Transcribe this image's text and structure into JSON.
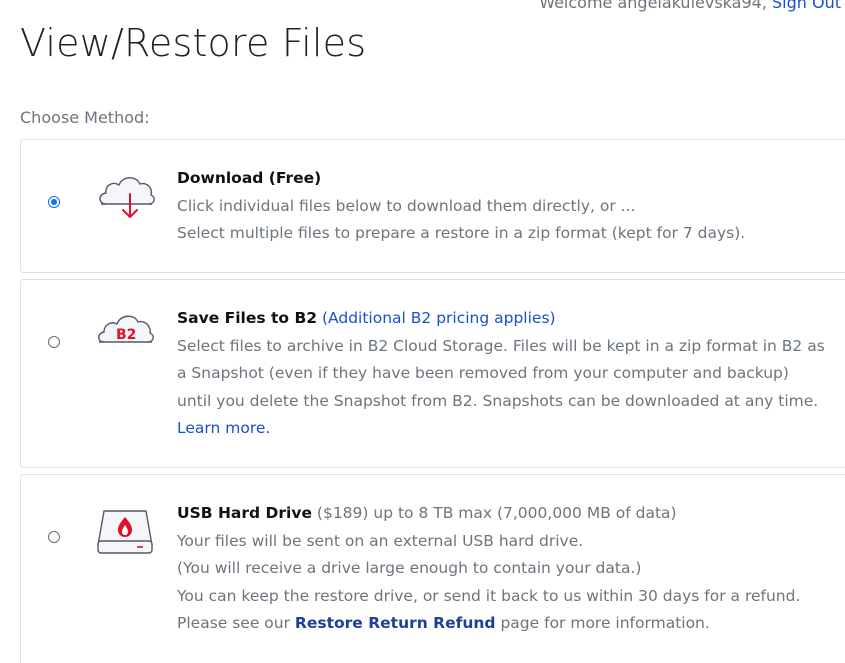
{
  "header": {
    "welcome_text": "Welcome angelakulevska94,",
    "sign_out": "Sign Out",
    "page_title": "View/Restore Files"
  },
  "choose_method_label": "Choose Method:",
  "options": {
    "download": {
      "selected": true,
      "title": "Download (Free)",
      "line1": "Click individual files below to download them directly, or ...",
      "line2": "Select multiple files to prepare a restore in a zip format (kept for 7 days)."
    },
    "b2": {
      "selected": false,
      "title": "Save Files to B2",
      "pricing_link": "(Additional B2 pricing applies)",
      "icon_label": "B2",
      "line1": "Select files to archive in B2 Cloud Storage. Files will be kept in a zip format in B2 as",
      "line2": "a Snapshot (even if they have been removed from your computer and backup)",
      "line3": "until you delete the Snapshot from B2. Snapshots can be downloaded at any time.",
      "learn_more": "Learn more."
    },
    "usb": {
      "selected": false,
      "title": "USB Hard Drive",
      "price_note": "($189) up to 8 TB max (7,000,000 MB of data)",
      "line1": "Your files will be sent on an external USB hard drive.",
      "line2": "(You will receive a drive large enough to contain your data.)",
      "line3": "You can keep the restore drive, or send it back to us within 30 days for a refund.",
      "line4_pre": "Please see our",
      "refund_link": "Restore Return Refund",
      "line4_post": "page for more information."
    }
  },
  "colors": {
    "accent_red": "#e0102a",
    "link_blue": "#1a4fd1",
    "radio_blue": "#0d6efd"
  },
  "icons": [
    "cloud-download-icon",
    "b2-cloud-icon",
    "usb-hard-drive-icon"
  ]
}
